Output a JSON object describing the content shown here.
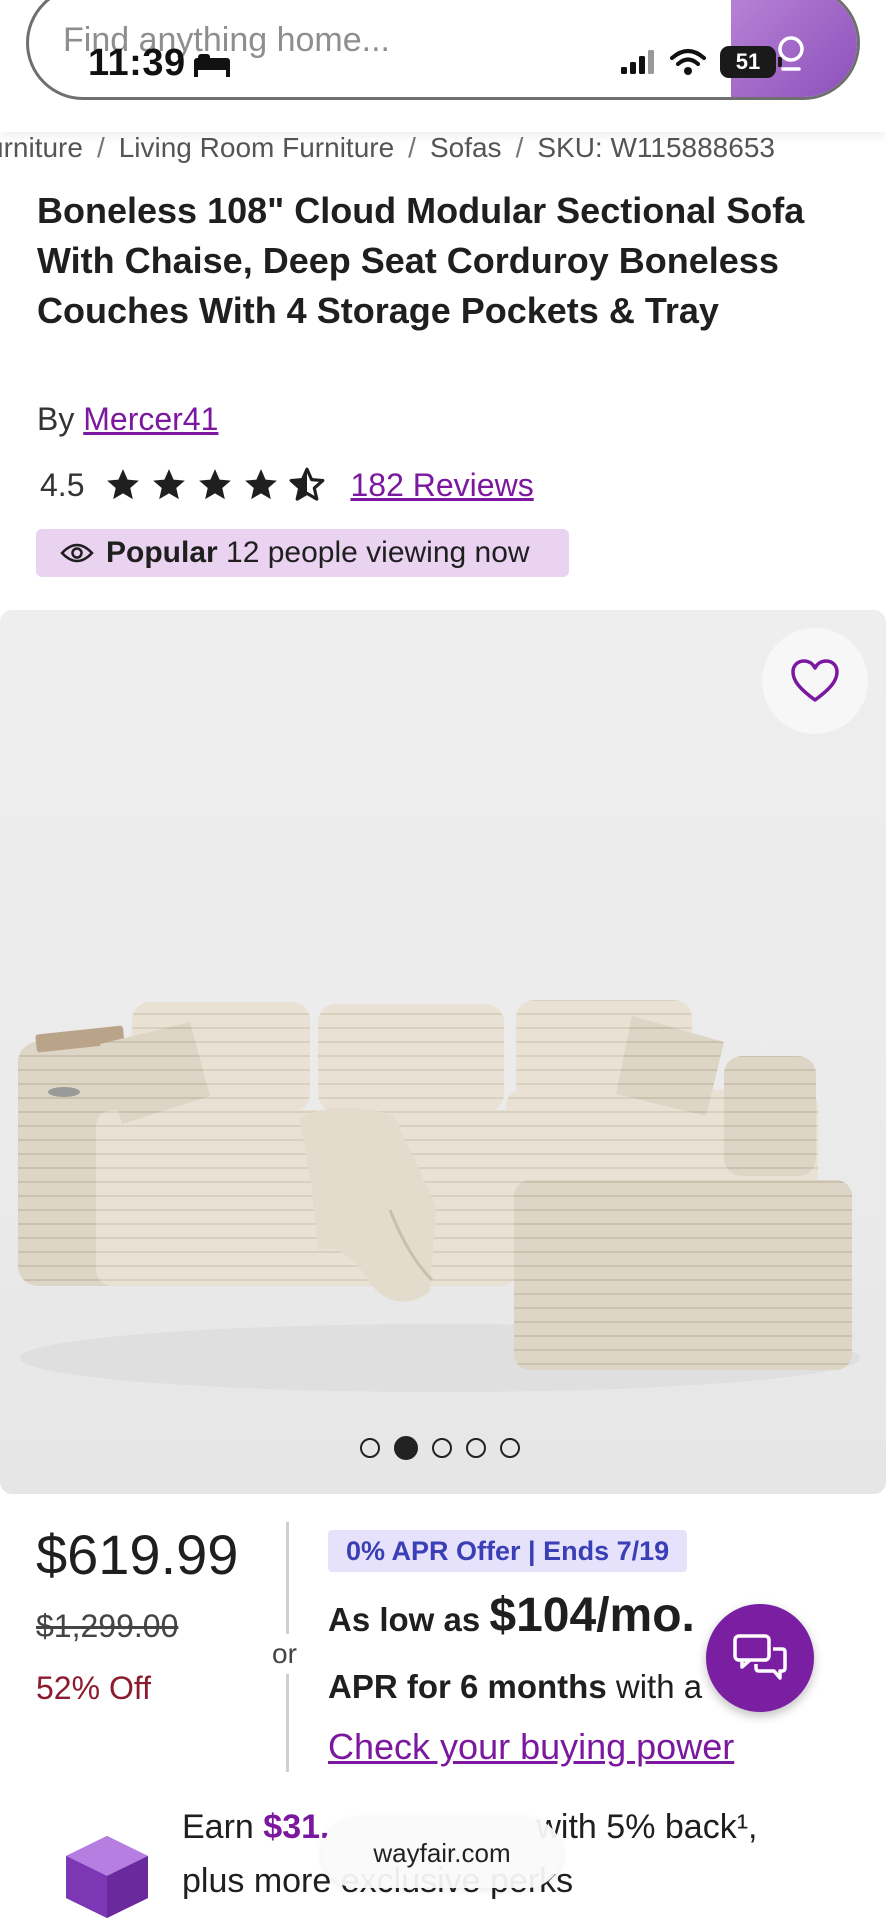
{
  "status_bar": {
    "time": "11:39",
    "battery": "51"
  },
  "search": {
    "placeholder": "Find anything home..."
  },
  "breadcrumb": [
    "urniture",
    "Living Room Furniture",
    "Sofas",
    "SKU: W115888653"
  ],
  "product": {
    "title": "Boneless 108\" Cloud Modular Sectional Sofa With Chaise, Deep Seat Corduroy Boneless Couches With 4 Storage Pockets & Tray",
    "by_label": "By",
    "brand": "Mercer41",
    "rating": "4.5",
    "rating_value": 4.5,
    "rating_max": 5,
    "reviews_label": "182 Reviews",
    "popular_label": "Popular",
    "popular_text": "12 people viewing now"
  },
  "gallery": {
    "image_count": 5,
    "active_index": 1
  },
  "pricing": {
    "price": "$619.99",
    "original_price": "$1,299.00",
    "discount": "52% Off",
    "or_label": "or",
    "apr_badge": "0% APR Offer | Ends 7/19",
    "low_prefix": "As low as",
    "low_amount": "$104/mo.",
    "apr_text_bold": "APR for 6 months",
    "apr_text_rest": "with a",
    "power_link": "Check your buying power"
  },
  "rewards": {
    "earn_prefix": "Earn",
    "amount": "$31.",
    "earn_suffix": "with 5% back¹,",
    "line2": "plus more exclusive perks"
  },
  "browser": {
    "url": "wayfair.com"
  },
  "colors": {
    "brand_purple": "#7b189f",
    "discount_red": "#8c1b2f",
    "popular_bg": "#ead3f0",
    "apr_bg": "#e6e2fb"
  }
}
